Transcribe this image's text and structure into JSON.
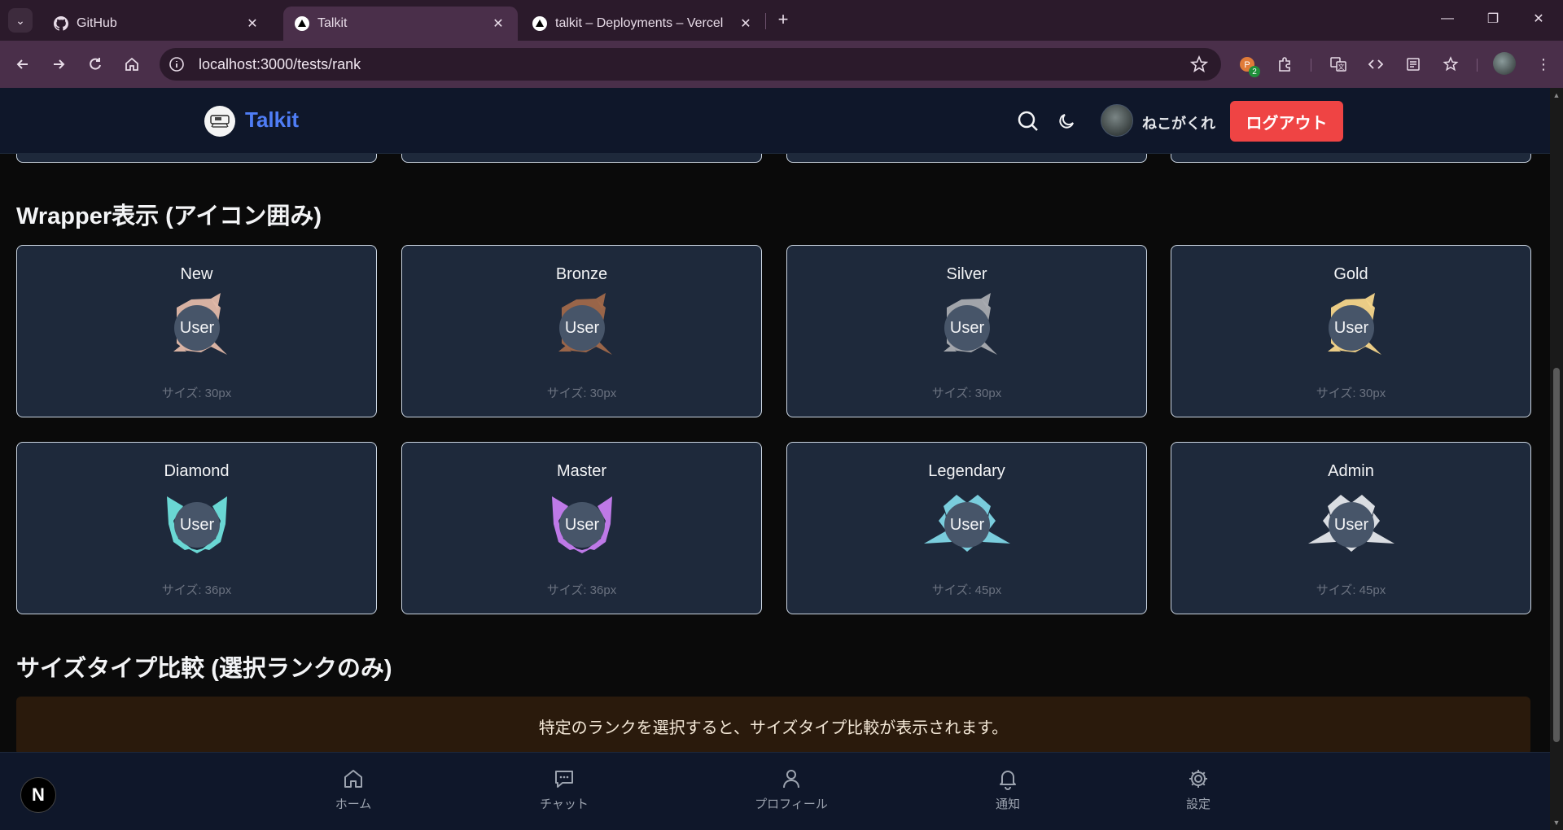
{
  "browser": {
    "tabs": [
      {
        "title": "GitHub",
        "icon": "github-icon"
      },
      {
        "title": "Talkit",
        "icon": "vercel-triangle-icon"
      },
      {
        "title": "talkit – Deployments – Vercel",
        "icon": "vercel-triangle-icon"
      }
    ],
    "url": "localhost:3000/tests/rank",
    "extension_badge": "2"
  },
  "header": {
    "logo_text": "Talkit",
    "user_name": "ねこがくれ",
    "logout_label": "ログアウト"
  },
  "sections": {
    "wrapper_title": "Wrapper表示 (アイコン囲み)",
    "size_compare_title": "サイズタイプ比較 (選択ランクのみ)",
    "size_compare_notice": "特定のランクを選択すると、サイズタイプ比較が表示されます。"
  },
  "avatar_label": "User",
  "ranks": [
    {
      "name": "New",
      "size": "サイズ: 30px",
      "color": "#e2b8a8"
    },
    {
      "name": "Bronze",
      "size": "サイズ: 30px",
      "color": "#a0684a"
    },
    {
      "name": "Silver",
      "size": "サイズ: 30px",
      "color": "#a9abb0"
    },
    {
      "name": "Gold",
      "size": "サイズ: 30px",
      "color": "#f5d58a"
    },
    {
      "name": "Diamond",
      "size": "サイズ: 36px",
      "color": "#6fe0dc"
    },
    {
      "name": "Master",
      "size": "サイズ: 36px",
      "color": "#c77df0"
    },
    {
      "name": "Legendary",
      "size": "サイズ: 45px",
      "color": "#7fd6e6"
    },
    {
      "name": "Admin",
      "size": "サイズ: 45px",
      "color": "#e5e7eb"
    }
  ],
  "bottom_nav": [
    {
      "label": "ホーム",
      "icon": "home-icon"
    },
    {
      "label": "チャット",
      "icon": "chat-icon"
    },
    {
      "label": "プロフィール",
      "icon": "user-icon"
    },
    {
      "label": "通知",
      "icon": "bell-icon"
    },
    {
      "label": "設定",
      "icon": "gear-icon"
    }
  ],
  "dev_badge": "N"
}
